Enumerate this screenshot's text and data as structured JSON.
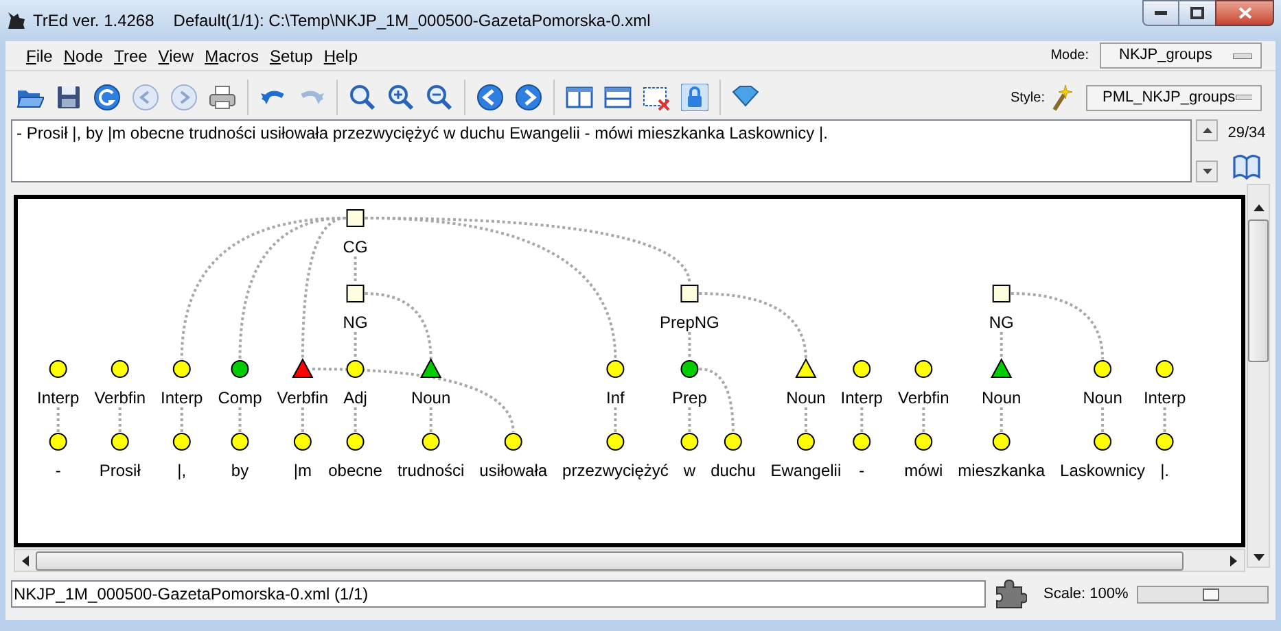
{
  "window": {
    "app_title": "TrEd ver. 1.4268",
    "file_title": "Default(1/1): C:\\Temp\\NKJP_1M_000500-GazetaPomorska-0.xml"
  },
  "menu": [
    "File",
    "Node",
    "Tree",
    "View",
    "Macros",
    "Setup",
    "Help"
  ],
  "mode": {
    "label": "Mode:",
    "value": "NKJP_groups"
  },
  "style": {
    "label": "Style:",
    "value": "PML_NKJP_groups"
  },
  "sentence": {
    "text": "- Prosił |, by |m obecne trudności usiłowała przezwyciężyć w duchu Ewangelii - mówi mieszkanka Laskownicy |.",
    "counter": "29/34"
  },
  "tree": {
    "nodes": [
      {
        "kind": "circle",
        "label": "Interp",
        "color": "#ffff00",
        "words": [
          {
            "text": "-"
          }
        ]
      },
      {
        "kind": "circle",
        "label": "Verbfin",
        "color": "#ffff00",
        "words": [
          {
            "text": "Prosił"
          }
        ]
      },
      {
        "kind": "group",
        "label": "CG",
        "children": [
          {
            "kind": "circle",
            "label": "Interp",
            "color": "#ffff00",
            "words": [
              {
                "text": "|,"
              }
            ],
            "head": false
          },
          {
            "kind": "circle",
            "label": "Comp",
            "color": "#00cc00",
            "words": [
              {
                "text": "by"
              }
            ],
            "head": false
          },
          {
            "kind": "triangle",
            "label": "Verbfin",
            "color": "#ff0000",
            "words": [
              {
                "text": "|m"
              },
              {
                "text": "usiłowała",
                "gap": true
              }
            ],
            "head": false
          },
          {
            "kind": "group",
            "label": "NG",
            "head": true,
            "children": [
              {
                "kind": "circle",
                "label": "Adj",
                "color": "#ffff00",
                "words": [
                  {
                    "text": "obecne"
                  }
                ],
                "head": true
              },
              {
                "kind": "triangle",
                "label": "Noun",
                "color": "#00cc00",
                "words": [
                  {
                    "text": "trudności"
                  }
                ],
                "head": false
              }
            ]
          },
          {
            "kind": "circle",
            "label": "Inf",
            "color": "#ffff00",
            "words": [
              {
                "text": "przezwyciężyć"
              }
            ],
            "head": false
          },
          {
            "kind": "group",
            "label": "PrepNG",
            "head": false,
            "children": [
              {
                "kind": "circle",
                "label": "Prep",
                "color": "#00cc00",
                "words": [
                  {
                    "text": "w"
                  },
                  {
                    "text": "duchu"
                  }
                ],
                "head": true
              },
              {
                "kind": "triangle",
                "label": "Noun",
                "color": "#ffff00",
                "words": [
                  {
                    "text": "Ewangelii"
                  }
                ],
                "head": false
              }
            ]
          }
        ]
      },
      {
        "kind": "circle",
        "label": "Interp",
        "color": "#ffff00",
        "words": [
          {
            "text": "-"
          }
        ]
      },
      {
        "kind": "circle",
        "label": "Verbfin",
        "color": "#ffff00",
        "words": [
          {
            "text": "mówi"
          }
        ]
      },
      {
        "kind": "group",
        "label": "NG",
        "children": [
          {
            "kind": "triangle",
            "label": "Noun",
            "color": "#00cc00",
            "words": [
              {
                "text": "mieszkanka"
              }
            ],
            "head": true
          },
          {
            "kind": "circle",
            "label": "Noun",
            "color": "#ffff00",
            "words": [
              {
                "text": "Laskownicy"
              }
            ],
            "head": false
          }
        ]
      },
      {
        "kind": "circle",
        "label": "Interp",
        "color": "#ffff00",
        "words": [
          {
            "text": "|."
          }
        ]
      }
    ]
  },
  "status_bar": {
    "file": "NKJP_1M_000500-GazetaPomorska-0.xml (1/1)",
    "scale_label": "Scale: 100%",
    "scale_slider": {
      "level": 0.57
    }
  }
}
